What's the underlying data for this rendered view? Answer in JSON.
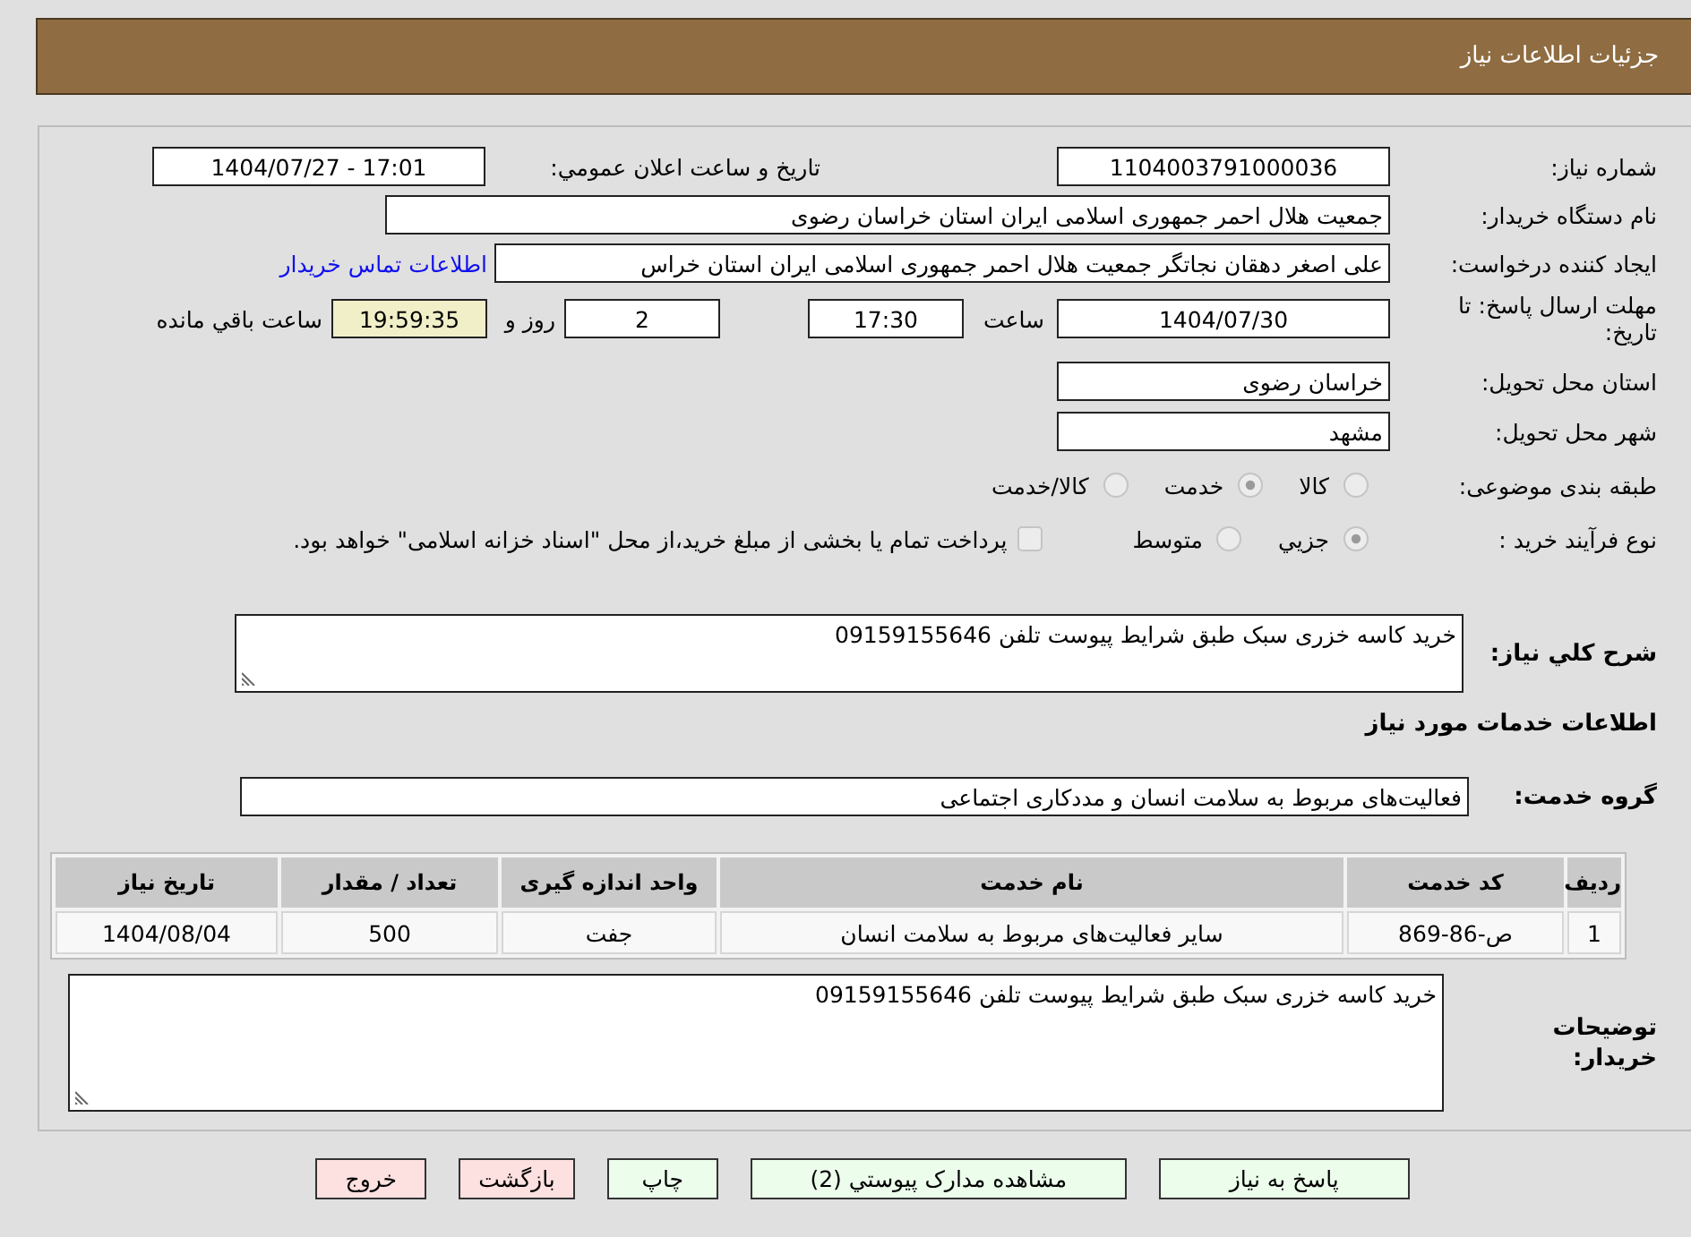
{
  "header": {
    "title": "جزئیات اطلاعات نیاز"
  },
  "need_number": {
    "label": "شماره نیاز:",
    "value": "1104003791000036"
  },
  "announce_datetime": {
    "label": "تاریخ و ساعت اعلان عمومي:",
    "value": "1404/07/27 - 17:01"
  },
  "buyer_org": {
    "label": "نام دستگاه خریدار:",
    "value": "جمعیت هلال احمر جمهوری اسلامی ایران استان خراسان رضوی"
  },
  "requester": {
    "label": "ایجاد کننده درخواست:",
    "value": "علی اصغر دهقان نجاتگر جمعیت هلال احمر جمهوری اسلامی ایران استان خراس",
    "contact_link": "اطلاعات تماس خریدار"
  },
  "deadline": {
    "label": "مهلت ارسال پاسخ: تا تاریخ:",
    "date": "1404/07/30",
    "time_label": "ساعت",
    "time": "17:30",
    "days": "2",
    "days_label": "روز و",
    "remaining": "19:59:35",
    "remaining_label": "ساعت باقي مانده"
  },
  "delivery_province": {
    "label": "استان محل تحویل:",
    "value": "خراسان رضوی"
  },
  "delivery_city": {
    "label": "شهر محل تحویل:",
    "value": "مشهد"
  },
  "category": {
    "label": "طبقه بندی موضوعی:",
    "disabled": true,
    "options": [
      {
        "label": "کالا",
        "selected": false
      },
      {
        "label": "خدمت",
        "selected": true
      },
      {
        "label": "کالا/خدمت",
        "selected": false
      }
    ]
  },
  "process": {
    "label": "نوع فرآیند خرید :",
    "disabled": true,
    "options": [
      {
        "label": "جزيي",
        "selected": true
      },
      {
        "label": "متوسط",
        "selected": false
      }
    ],
    "treasury": {
      "label": "پرداخت تمام یا بخشی از مبلغ خرید،از محل \"اسناد خزانه اسلامی\" خواهد بود.",
      "checked": false
    }
  },
  "description": {
    "label": "شرح کلي نیاز:",
    "value": "خرید کاسه خزری سبک طبق شرایط پیوست تلفن 09159155646"
  },
  "services_title": "اطلاعات خدمات مورد نیاز",
  "service_group": {
    "label": "گروه خدمت:",
    "value": "فعالیت‌های مربوط به سلامت انسان و مددکاری اجتماعی"
  },
  "table": {
    "columns": [
      "ردیف",
      "کد خدمت",
      "نام خدمت",
      "واحد اندازه گیری",
      "تعداد / مقدار",
      "تاریخ نیاز"
    ],
    "rows": [
      [
        "1",
        "ص-86-869",
        "سایر فعالیت‌های مربوط به سلامت انسان",
        "جفت",
        "500",
        "1404/08/04"
      ]
    ]
  },
  "buyer_notes": {
    "label": "توضیحات خریدار:",
    "value": "خرید کاسه خزری سبک طبق شرایط پیوست تلفن 09159155646"
  },
  "buttons": [
    {
      "label": "پاسخ به نیاز",
      "kind": "normal"
    },
    {
      "label": "مشاهده مدارک پیوستي (2)",
      "kind": "normal"
    },
    {
      "label": "چاپ",
      "kind": "normal"
    },
    {
      "label": "بازگشت",
      "kind": "danger"
    },
    {
      "label": "خروج",
      "kind": "danger"
    }
  ]
}
